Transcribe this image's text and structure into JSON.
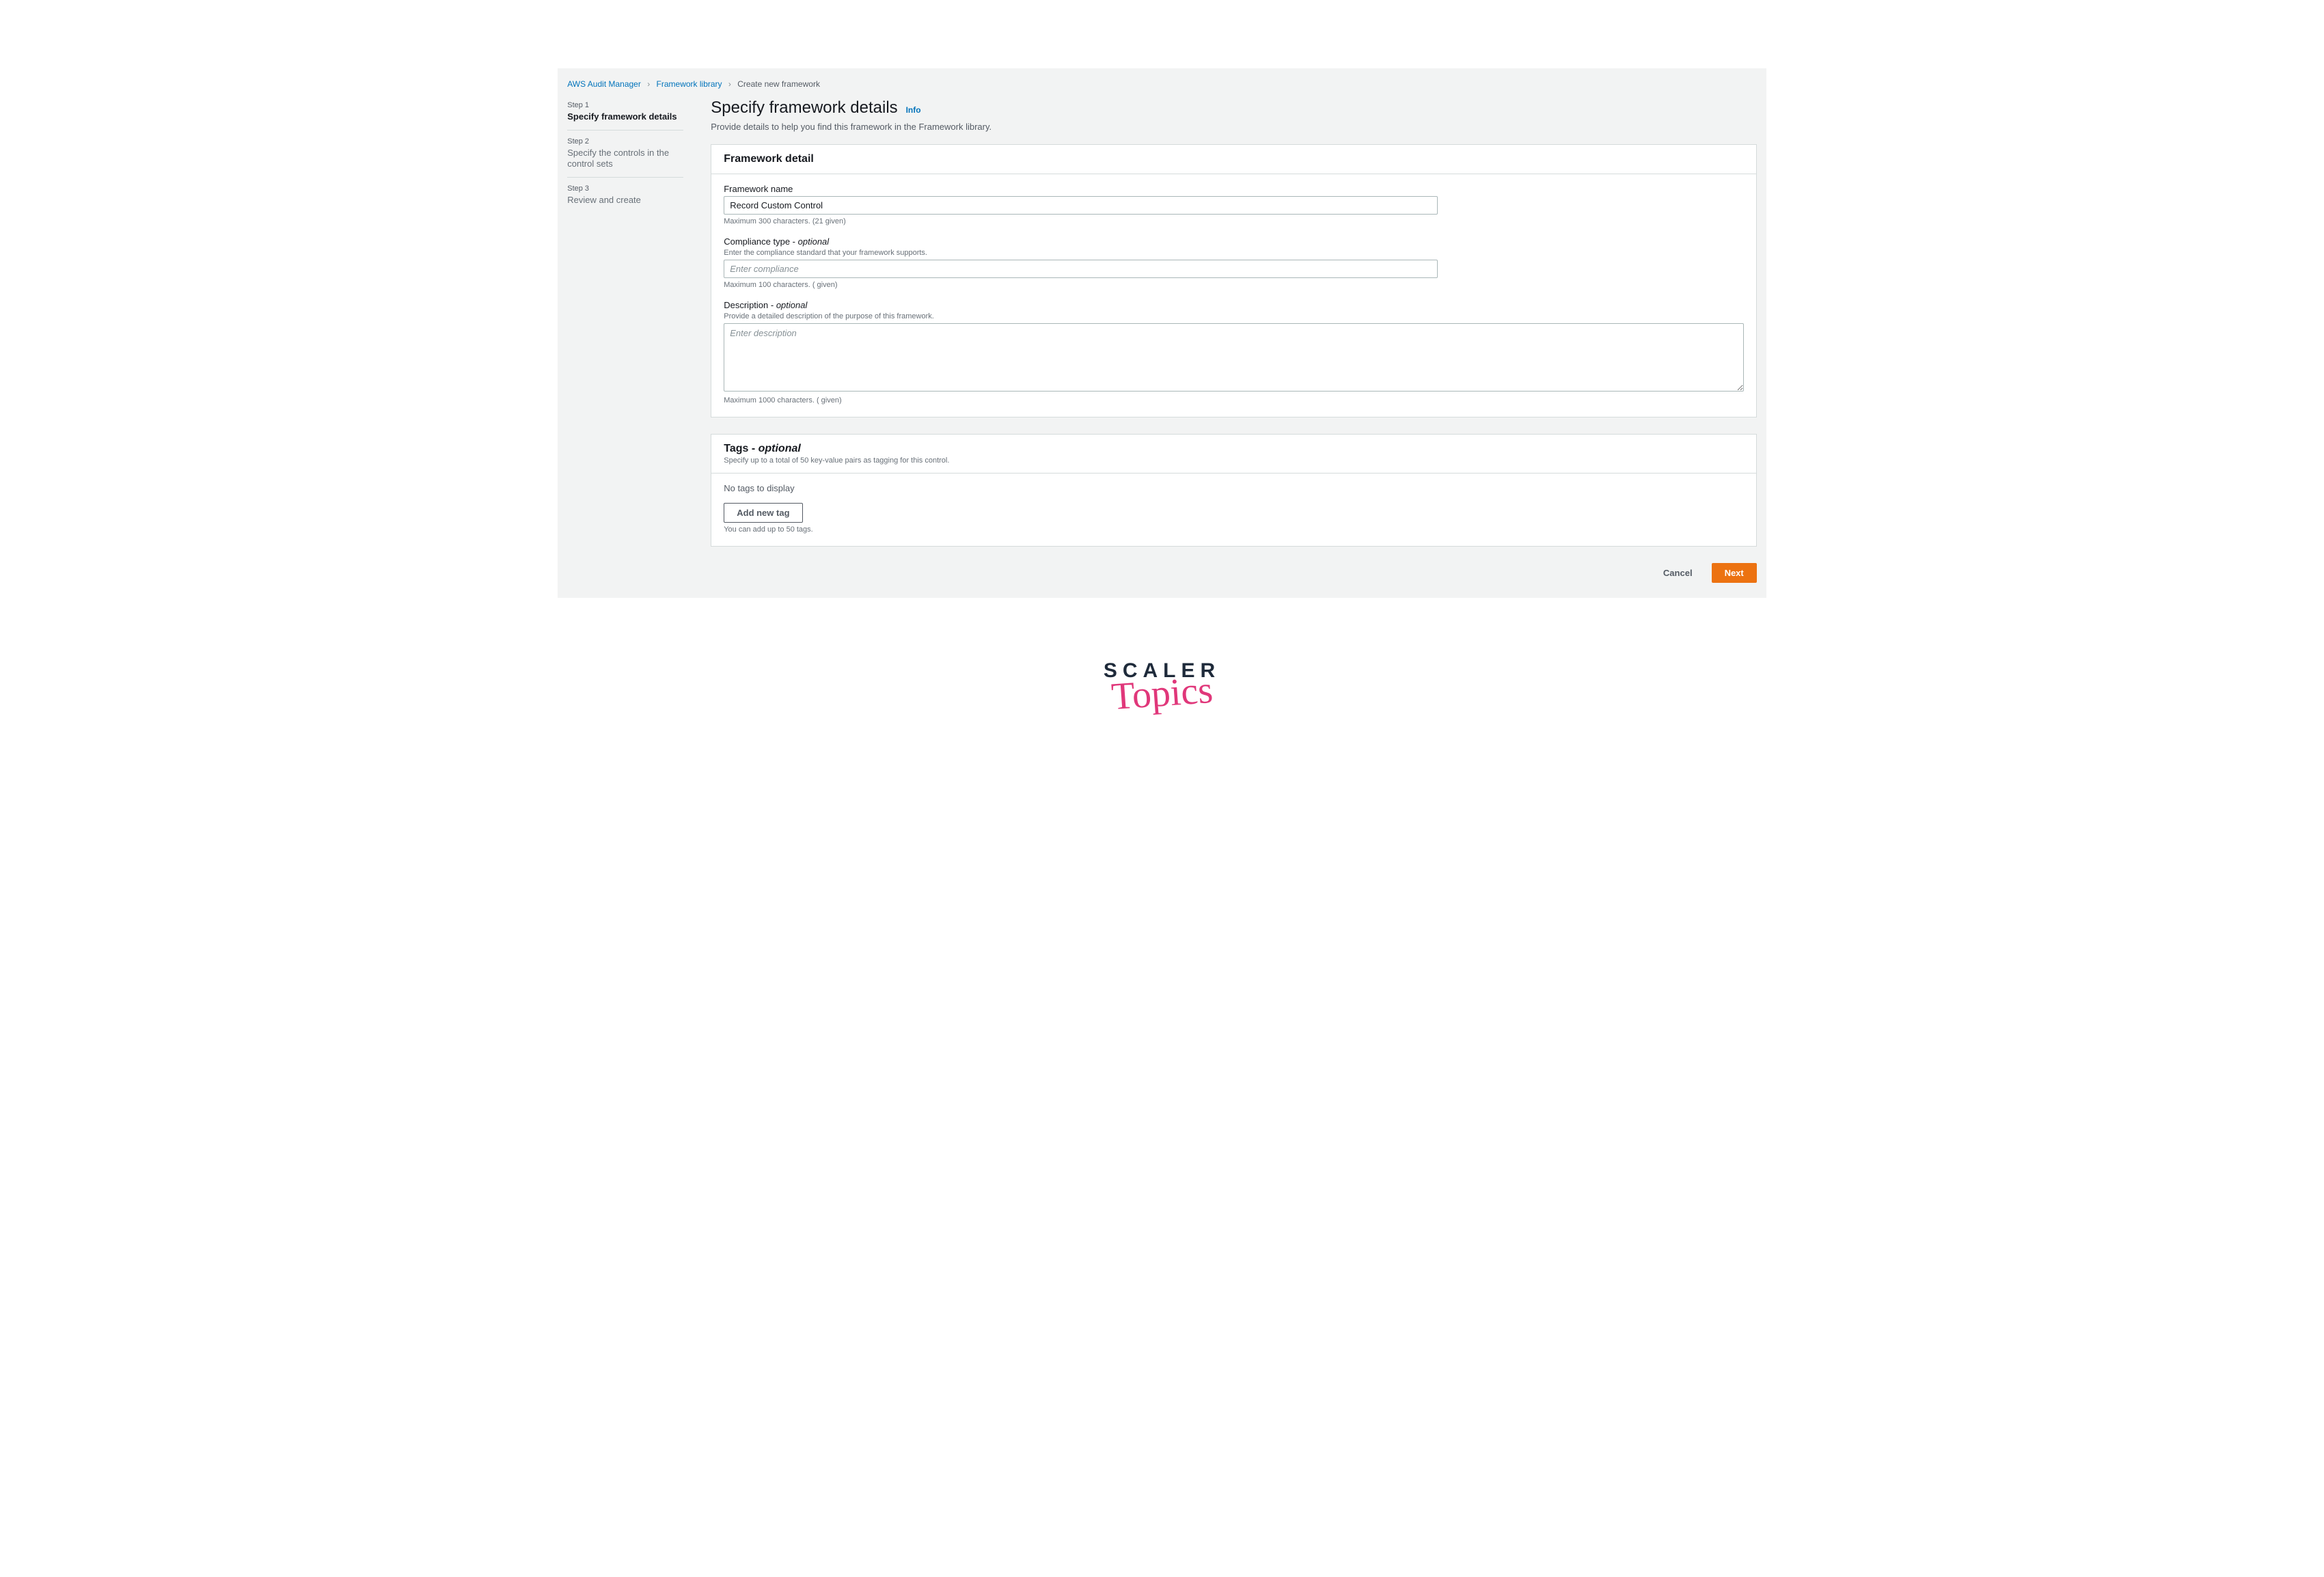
{
  "breadcrumb": {
    "items": [
      {
        "label": "AWS Audit Manager",
        "link": true
      },
      {
        "label": "Framework library",
        "link": true
      },
      {
        "label": "Create new framework",
        "link": false
      }
    ]
  },
  "steps": [
    {
      "num": "Step 1",
      "title": "Specify framework details",
      "active": true
    },
    {
      "num": "Step 2",
      "title": "Specify the controls in the control sets",
      "active": false
    },
    {
      "num": "Step 3",
      "title": "Review and create",
      "active": false
    }
  ],
  "page": {
    "title": "Specify framework details",
    "info": "Info",
    "subtitle": "Provide details to help you find this framework in the Framework library."
  },
  "detail_panel": {
    "heading": "Framework detail",
    "name": {
      "label": "Framework name",
      "value": "Record Custom Control",
      "helper": "Maximum 300 characters. (21 given)"
    },
    "compliance": {
      "label": "Compliance type - ",
      "suffix": "optional",
      "hint": "Enter the compliance standard that your framework supports.",
      "placeholder": "Enter compliance",
      "value": "",
      "helper": "Maximum 100 characters. ( given)"
    },
    "description": {
      "label": "Description - ",
      "suffix": "optional",
      "hint": "Provide a detailed description of the purpose of this framework.",
      "placeholder": "Enter description",
      "value": "",
      "helper": "Maximum 1000 characters. ( given)"
    }
  },
  "tags_panel": {
    "heading": "Tags - ",
    "suffix": "optional",
    "subdesc": "Specify up to a total of 50 key-value pairs as tagging for this control.",
    "empty": "No tags to display",
    "add_button": "Add new tag",
    "helper": "You can add up to 50 tags."
  },
  "footer": {
    "cancel": "Cancel",
    "next": "Next"
  },
  "brand": {
    "line1": "SCALER",
    "line2": "Topics"
  }
}
